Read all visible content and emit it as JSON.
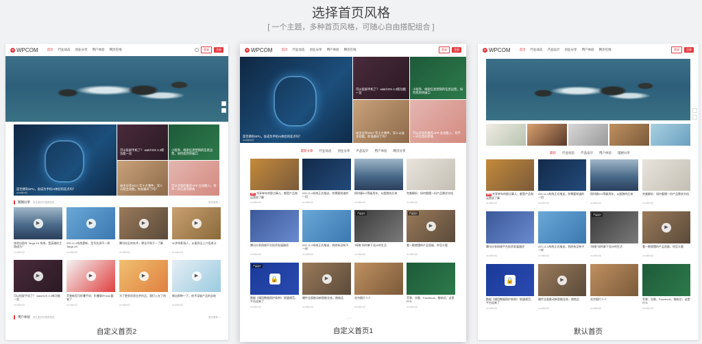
{
  "heading": {
    "title": "选择首页风格",
    "subtitle": "[ 一个主题，多种首页风格，可随心自由搭配组合 ]"
  },
  "brand": {
    "logo_text": "WPCOM",
    "logo_mark": "W",
    "accent": "#e0393e"
  },
  "nav": {
    "items": [
      "首页",
      "行业动态",
      "创业分享",
      "用户体验",
      "网页在线"
    ],
    "login": "登录",
    "register": "注册"
  },
  "nav_default": {
    "items": [
      "首页",
      "行业动态",
      "产品设计",
      "创业分享",
      "用户体验",
      "网页在线"
    ]
  },
  "cards": {
    "c2": {
      "label": "自定义首页2"
    },
    "c1": {
      "label": "自定义首页1"
    },
    "c0": {
      "label": "默认首页"
    }
  },
  "feature": {
    "main_title": "是否拥有NPU，会成为手机AI体验的差点吗？",
    "tiles": [
      {
        "title": "可以投屏手机了？ watchOS 4.3新功能一览"
      },
      {
        "title": "小程序、线索信息营销的信息运营，如何找到突破口"
      },
      {
        "title": "站主分享2017 年十大事件，深入公益主动能。你准备好了吗？"
      },
      {
        "title": "可以开放的推荐APP 主动能入。何不一开信息的新角"
      }
    ]
  },
  "sections": {
    "featured": {
      "title": "图图分享",
      "sub": "前往美好的视角感觉",
      "more": "更多推荐 >"
    },
    "ux": {
      "title": "用户体验",
      "sub": "前往美好的视角感觉",
      "more": "更多推荐 >"
    }
  },
  "tabs1": [
    "最新文章",
    "行业动态",
    "创业分享",
    "产品设计",
    "用户体验",
    "网页分享"
  ],
  "tabs0": [
    "最新",
    "行业动态",
    "产品设计",
    "用户体验",
    "理想分享"
  ],
  "tag_hot": "推荐",
  "tag_product": "产品设计",
  "posts": [
    {
      "title": "体验出租车 Targa 4S 系统，是英雄的主角成为？"
    },
    {
      "title": "iOS 11.4系统更新，型号实测不一样 Targa 4S"
    },
    {
      "title": "腾讯社区的技术，想法不知于一了解"
    },
    {
      "title": "30岁的职场人，从复到当上介绍老计"
    },
    {
      "title": "可以投屏手机了？ watchOS 4.3新功能一览"
    },
    {
      "title": "苹果新型可折叠手机：折叠屏iPhone要来了"
    },
    {
      "title": "为了更多优质业余作品，我们入在了的"
    },
    {
      "title": "做出那种一下，给予深度产品的总结"
    },
    {
      "title": "共享单车的那点事儿，都是产品和运营说了算"
    },
    {
      "title": "iOS 11.4系统正式推送，你需要知道的一切"
    },
    {
      "title": "保时捷911等级用车，从超跑的后来"
    },
    {
      "title": "完美解析：如何看懂一份产品需求文档"
    },
    {
      "title": "腾讯分享网络平台投资发展路径"
    },
    {
      "title": "iOS 11.4系统正式推送，到底有没有不一样"
    },
    {
      "title": "\"网络\"如何拿下设计的生活"
    },
    {
      "title": "看一眼就懂的产品思维，你怎么看"
    },
    {
      "title": "数据《通用数据保护条例》 欧盟规范，平台迎来了"
    },
    {
      "title": "硬件全面推动新智能业态，跑商品"
    },
    {
      "title": "北京图片人人"
    },
    {
      "title": "苹果、谷歌、Facebook、微软总，这是什么"
    }
  ],
  "meta_date": "2018年05月",
  "meta_views": "1,058",
  "page_dots": "• • • • •",
  "page_data_icon": "search-icon"
}
